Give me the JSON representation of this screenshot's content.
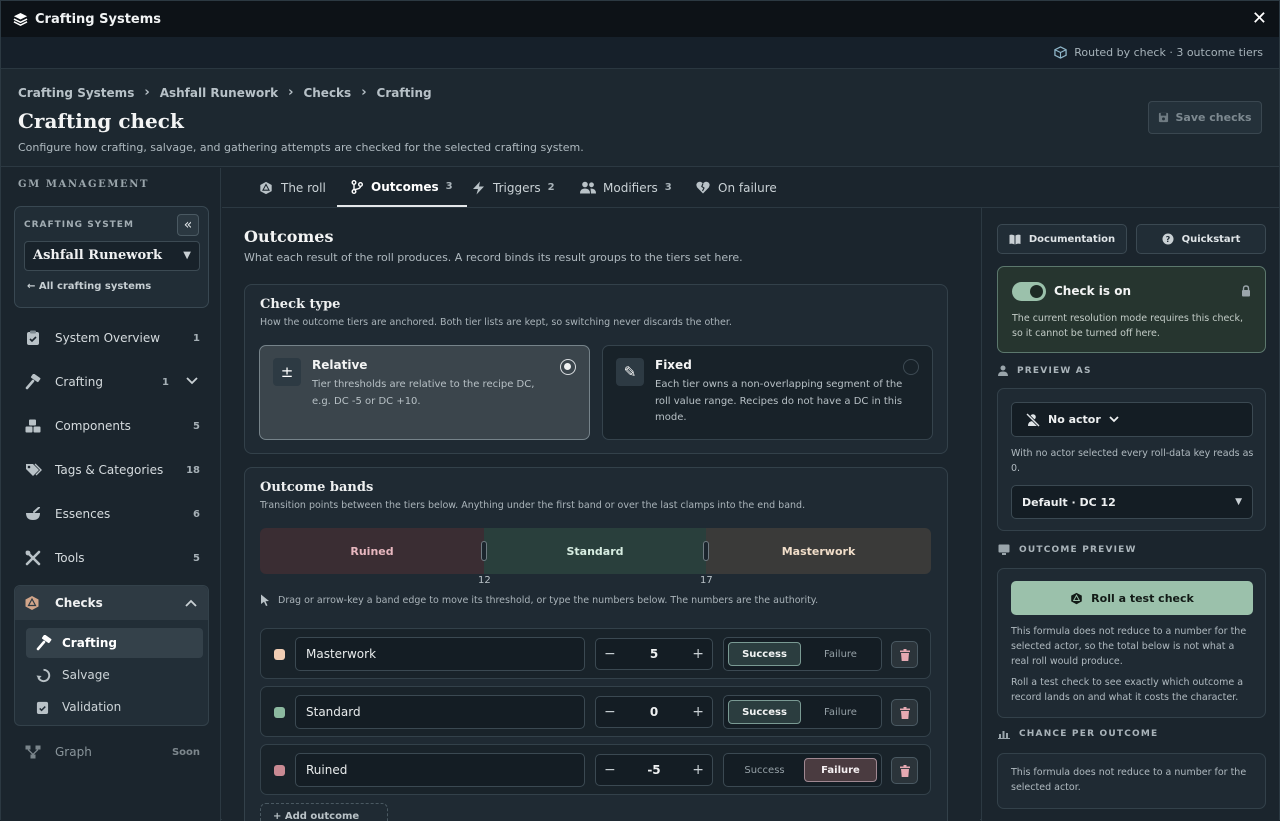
{
  "window": {
    "title": "Crafting Systems",
    "close_label": "✕"
  },
  "routebar": {
    "text": "Routed by check · 3 outcome tiers"
  },
  "breadcrumbs": [
    "Crafting Systems",
    "Ashfall Runework",
    "Checks",
    "Crafting"
  ],
  "breadcrumb_sep": "›",
  "page": {
    "title": "Crafting check",
    "description": "Configure how crafting, salvage, and gathering attempts are checked for the selected crafting system.",
    "save_label": "Save checks"
  },
  "sidebar": {
    "section_label": "GM MANAGEMENT",
    "crafting_system": {
      "label": "CRAFTING SYSTEM",
      "selected": "Ashfall Runework",
      "all_link": "All crafting systems",
      "collapse_icon": "«"
    },
    "items": [
      {
        "label": "System Overview",
        "count": "1",
        "icon": "clipboard-icon"
      },
      {
        "label": "Crafting",
        "count": "1",
        "icon": "hammer-icon"
      },
      {
        "label": "Components",
        "count": "5",
        "icon": "boxes-icon"
      },
      {
        "label": "Tags & Categories",
        "count": "18",
        "icon": "tags-icon"
      },
      {
        "label": "Essences",
        "count": "6",
        "icon": "mortar-icon"
      },
      {
        "label": "Tools",
        "count": "5",
        "icon": "tools-icon"
      }
    ],
    "checks": {
      "label": "Checks",
      "subitems": [
        {
          "label": "Crafting",
          "active": true
        },
        {
          "label": "Salvage",
          "active": false
        },
        {
          "label": "Validation",
          "active": false
        }
      ]
    },
    "graph": {
      "label": "Graph",
      "badge": "Soon"
    }
  },
  "tabs": [
    {
      "label": "The roll",
      "count": "",
      "icon": "dice-icon"
    },
    {
      "label": "Outcomes",
      "count": "3",
      "icon": "branch-icon",
      "active": true
    },
    {
      "label": "Triggers",
      "count": "2",
      "icon": "bolt-icon"
    },
    {
      "label": "Modifiers",
      "count": "3",
      "icon": "users-icon"
    },
    {
      "label": "On failure",
      "count": "",
      "icon": "heart-broken-icon"
    }
  ],
  "outcomes": {
    "title": "Outcomes",
    "description": "What each result of the roll produces. A record binds its result groups to the tiers set here.",
    "check_type": {
      "title": "Check type",
      "description": "How the outcome tiers are anchored. Both tier lists are kept, so switching never discards the other.",
      "options": [
        {
          "name": "Relative",
          "icon_glyph": "±",
          "text": "Tier thresholds are relative to the recipe DC, e.g. DC -5 or DC +10.",
          "selected": true
        },
        {
          "name": "Fixed",
          "icon_glyph": "✎",
          "text": "Each tier owns a non-overlapping segment of the roll value range. Recipes do not have a DC in this mode.",
          "selected": false
        }
      ]
    },
    "bands": {
      "title": "Outcome bands",
      "description": "Transition points between the tiers below. Anything under the first band or over the last clamps into the end band.",
      "segments": [
        {
          "label": "Ruined",
          "color": "#3a2d33",
          "text_color": "#e7b7bf"
        },
        {
          "label": "Standard",
          "color": "#293f3c",
          "text_color": "#d6ece1"
        },
        {
          "label": "Masterwork",
          "color": "#3a3a39",
          "text_color": "#f0ddc9"
        }
      ],
      "thresholds": [
        "12",
        "17"
      ],
      "hint": "Drag or arrow-key a band edge to move its threshold, or type the numbers below. The numbers are the authority."
    },
    "tiers": [
      {
        "name": "Masterwork",
        "value": "5",
        "color": "#f0cdb4",
        "result": "success"
      },
      {
        "name": "Standard",
        "value": "0",
        "color": "#8cb9a0",
        "result": "success"
      },
      {
        "name": "Ruined",
        "value": "-5",
        "color": "#c98a93",
        "result": "failure"
      }
    ],
    "success_label": "Success",
    "failure_label": "Failure",
    "add_tier_label": "+ Add outcome tier"
  },
  "right": {
    "documentation_label": "Documentation",
    "quickstart_label": "Quickstart",
    "check_on": {
      "title": "Check is on",
      "text": "The current resolution mode requires this check, so it cannot be turned off here."
    },
    "preview_as": {
      "label": "PREVIEW AS",
      "actor": "No actor",
      "note": "With no actor selected every roll-data key reads as 0.",
      "dc_selected": "Default · DC 12"
    },
    "outcome_preview": {
      "label": "OUTCOME PREVIEW",
      "roll_label": "Roll a test check",
      "text1": "This formula does not reduce to a number for the selected actor, so the total below is not what a real roll would produce.",
      "text2": "Roll a test check to see exactly which outcome a record lands on and what it costs the character."
    },
    "chance": {
      "label": "CHANCE PER OUTCOME",
      "text": "This formula does not reduce to a number for the selected actor."
    }
  }
}
